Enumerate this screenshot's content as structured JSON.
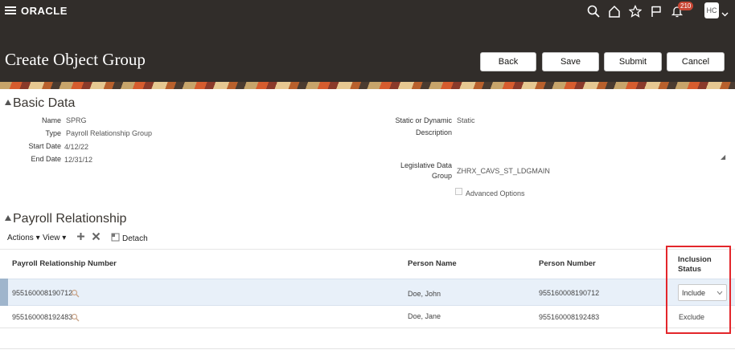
{
  "topbar": {
    "logo": "ORACLE",
    "notification_count": "210",
    "avatar_initials": "HC",
    "icons": [
      "menu-icon",
      "search-icon",
      "home-icon",
      "star-icon",
      "flag-icon",
      "bell-icon"
    ]
  },
  "header": {
    "title": "Create Object Group",
    "buttons": {
      "back": "Back",
      "save": "Save",
      "submit": "Submit",
      "cancel": "Cancel"
    }
  },
  "basic_data": {
    "section_title": "Basic Data",
    "name_label": "Name",
    "name_value": "SPRG",
    "type_label": "Type",
    "type_value": "Payroll Relationship Group",
    "start_label": "Start Date",
    "start_value": "4/12/22",
    "end_label": "End Date",
    "end_value": "12/31/12",
    "static_label": "Static or Dynamic",
    "static_value": "Static",
    "description_label": "Description",
    "description_value": "",
    "ldg_label_line1": "Legislative Data",
    "ldg_label_line2": "Group",
    "ldg_value": "ZHRX_CAVS_ST_LDGMAIN",
    "advanced_options": "Advanced Options"
  },
  "payroll_relationship": {
    "section_title": "Payroll Relationship",
    "toolbar": {
      "actions": "Actions ▾",
      "view": "View ▾",
      "detach": "Detach"
    },
    "columns": {
      "number": "Payroll Relationship Number",
      "person_name": "Person Name",
      "person_number": "Person Number",
      "inclusion_line1": "Inclusion",
      "inclusion_line2": "Status"
    },
    "rows": [
      {
        "number": "955160008190712",
        "person_name": "Doe, John",
        "person_number": "955160008190712",
        "inclusion_status": "Include"
      },
      {
        "number": "955160008192483",
        "person_name": "Doe, Jane",
        "person_number": "955160008192483",
        "inclusion_status": "Exclude"
      }
    ]
  },
  "colors": {
    "header_bg": "#312d2a",
    "highlight_border": "#e3262b",
    "selected_row_bg": "#e8f0f9"
  }
}
